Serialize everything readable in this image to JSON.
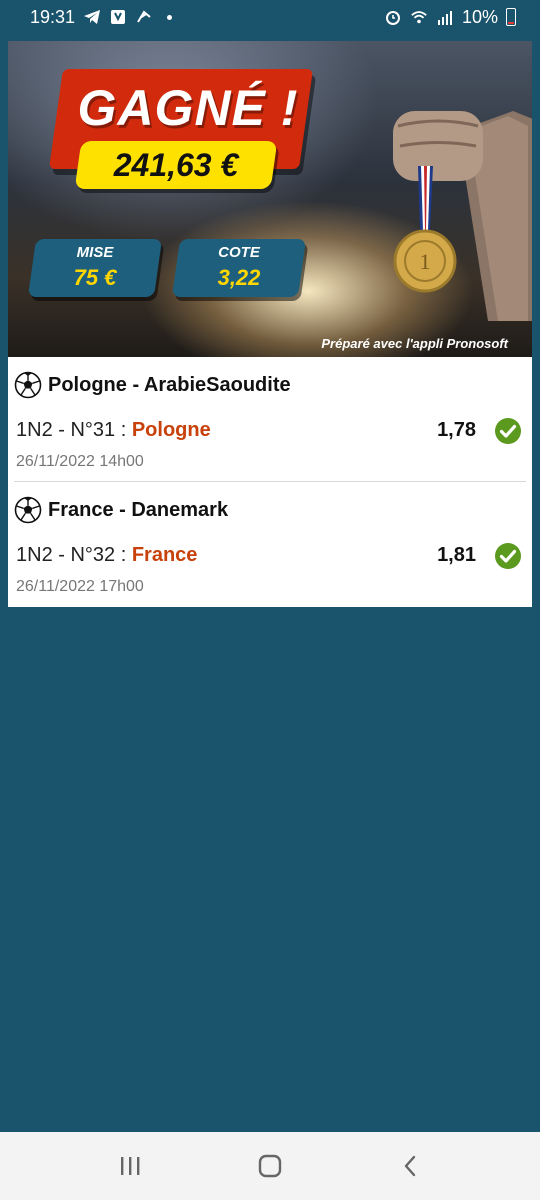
{
  "status_bar": {
    "time": "19:31",
    "battery_percent": "10%",
    "left_icons": [
      "telegram-icon",
      "shield-icon",
      "tiktok-icon",
      "notification-dot-icon"
    ],
    "right_icons": [
      "alarm-icon",
      "wifi-icon",
      "signal-icon",
      "battery-icon"
    ]
  },
  "banner": {
    "title": "GAGNÉ !",
    "amount": "241,63 €",
    "mise_label": "MISE",
    "mise_value": "75 €",
    "cote_label": "COTE",
    "cote_value": "3,22",
    "footer": "Préparé avec l'appli Pronosoft"
  },
  "bets": [
    {
      "match": "Pologne - ArabieSaoudite",
      "bet_prefix": "1N2 - N°31 : ",
      "choice": "Pologne",
      "odd": "1,78",
      "date": "26/11/2022 14h00",
      "status": "won"
    },
    {
      "match": "France - Danemark",
      "bet_prefix": "1N2 - N°32 : ",
      "choice": "France",
      "odd": "1,81",
      "date": "26/11/2022 17h00",
      "status": "won"
    }
  ],
  "colors": {
    "background": "#1a536c",
    "choice": "#c8410b",
    "check": "#5b9a1f",
    "banner_red": "#d12a0c",
    "banner_yellow": "#ffe100"
  },
  "nav_bar": {
    "buttons": [
      "recent-apps-icon",
      "home-icon",
      "back-icon"
    ]
  }
}
